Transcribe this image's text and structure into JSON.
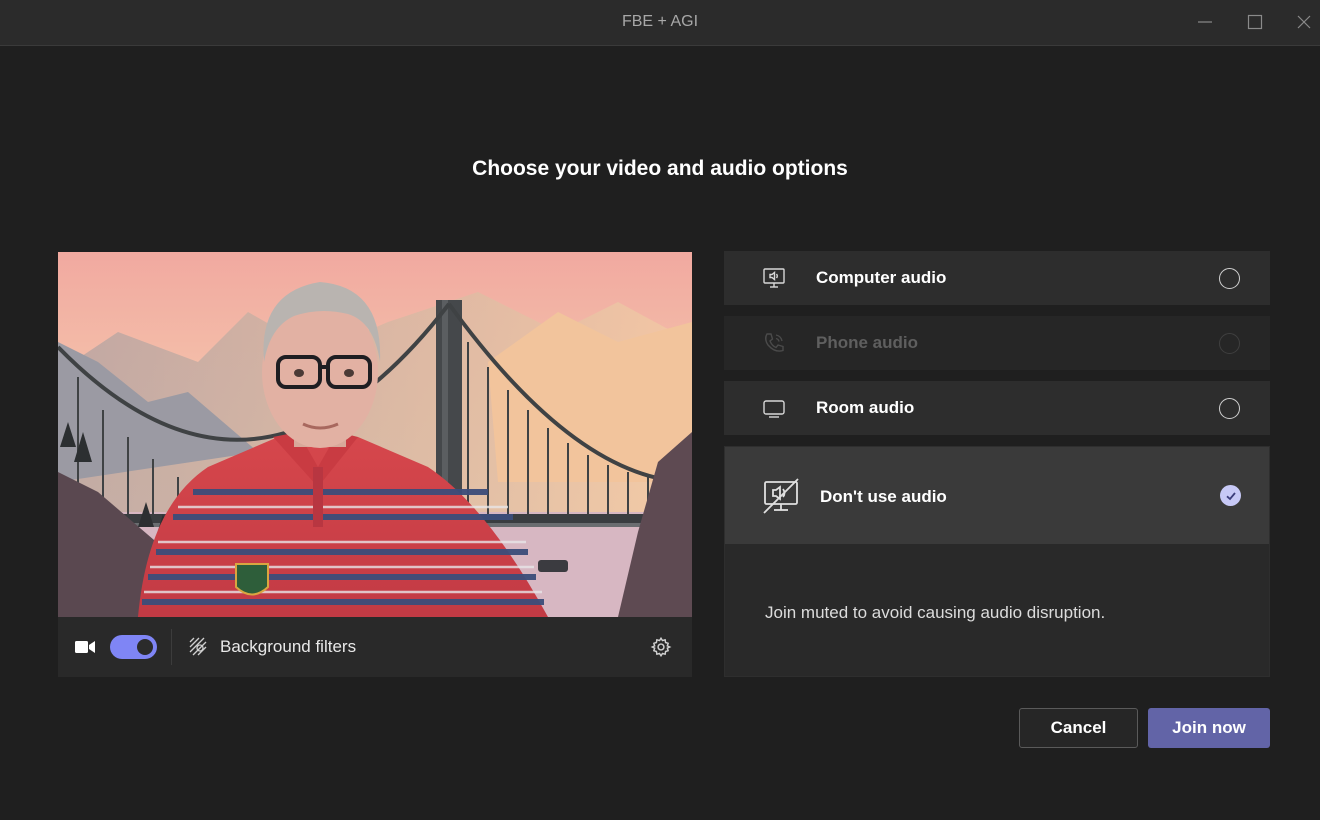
{
  "window": {
    "title": "FBE + AGI"
  },
  "heading": "Choose your video and audio options",
  "video": {
    "camera_on": true,
    "background_filters_label": "Background filters"
  },
  "audio_options": {
    "computer": {
      "label": "Computer audio",
      "selected": false,
      "enabled": true
    },
    "phone": {
      "label": "Phone audio",
      "selected": false,
      "enabled": false
    },
    "room": {
      "label": "Room audio",
      "selected": false,
      "enabled": true
    },
    "none": {
      "label": "Don't use audio",
      "selected": true,
      "enabled": true,
      "description": "Join muted to avoid causing audio disruption."
    }
  },
  "buttons": {
    "cancel": "Cancel",
    "join": "Join now"
  },
  "colors": {
    "background": "#1f1f1f",
    "accent": "#6264a7",
    "toggle": "#7f85f5"
  },
  "icons": {
    "minimize": "minimize-icon",
    "maximize": "maximize-icon",
    "close": "close-icon",
    "camera": "video-camera-icon",
    "background_filters": "background-effects-icon",
    "settings": "gear-icon",
    "computer_audio": "computer-speaker-icon",
    "phone_audio": "phone-icon",
    "room_audio": "room-display-icon",
    "no_audio": "no-audio-icon",
    "selected": "checkmark-icon"
  }
}
